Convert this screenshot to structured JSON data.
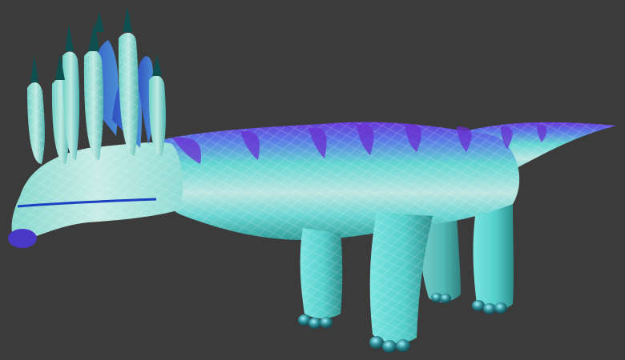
{
  "viewport": {
    "background_color": "#3b3b3b",
    "model_name": "",
    "model_kind": "3d-creature-render"
  },
  "colors": {
    "skin_light": "#bfe8df",
    "skin_teal": "#5fd6d0",
    "skin_dark": "#2f9a95",
    "stripe_purple": "#7a3fd6",
    "stripe_blue": "#3a52c8",
    "spike_tip": "#0f4a4a",
    "claw": "#1f5f66"
  },
  "icons": []
}
